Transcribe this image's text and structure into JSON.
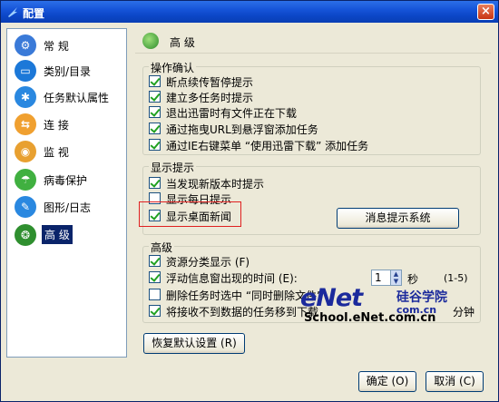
{
  "window": {
    "title": "配置",
    "close": "×"
  },
  "sidebar": {
    "items": [
      {
        "label": "常 规",
        "icon": "settings-icon",
        "color": "#3a7ad8"
      },
      {
        "label": "类别/目录",
        "icon": "folder-icon",
        "color": "#1c78d8"
      },
      {
        "label": "任务默认属性",
        "icon": "gear-icon",
        "color": "#2a88e0"
      },
      {
        "label": "连 接",
        "icon": "connection-icon",
        "color": "#f0a030"
      },
      {
        "label": "监 视",
        "icon": "monitor-icon",
        "color": "#e8a030"
      },
      {
        "label": "病毒保护",
        "icon": "virus-protection-icon",
        "color": "#40b040"
      },
      {
        "label": "图形/日志",
        "icon": "log-icon",
        "color": "#2a88e0"
      },
      {
        "label": "高 级",
        "icon": "advanced-icon",
        "color": "#2f8f2f"
      }
    ]
  },
  "header": {
    "title": "高 级"
  },
  "group_confirm": {
    "title": "操作确认",
    "items": [
      {
        "label": "断点续传暂停提示",
        "checked": true
      },
      {
        "label": "建立多任务时提示",
        "checked": true
      },
      {
        "label": "退出迅雷时有文件正在下载",
        "checked": true
      },
      {
        "label": "通过拖曳URL到悬浮窗添加任务",
        "checked": true
      },
      {
        "label": "通过IE右键菜单 “使用迅雷下载” 添加任务",
        "checked": true
      }
    ]
  },
  "group_display": {
    "title": "显示提示",
    "items": [
      {
        "label": "当发现新版本时提示",
        "checked": true
      },
      {
        "label": "显示每日提示",
        "checked": false
      },
      {
        "label": "显示桌面新闻",
        "checked": true
      }
    ],
    "button": "消息提示系统"
  },
  "group_advanced": {
    "title": "高级",
    "items": [
      {
        "label": "资源分类显示 (F)",
        "checked": true
      },
      {
        "label": "浮动信息窗出现的时间 (E):",
        "checked": true
      },
      {
        "label": "删除任务时选中 “同时删除文件”",
        "checked": false
      },
      {
        "label": "将接收不到数据的任务移到下载",
        "checked": true
      }
    ],
    "spin_value": "1",
    "spin_unit": "秒",
    "spin_range": "(1-5)",
    "tail_text": "分钟"
  },
  "buttons": {
    "restore": "恢复默认设置 (R)",
    "ok": "确定 (O)",
    "cancel": "取消 (C)"
  },
  "watermark": {
    "logo": "eNet",
    "cn": "硅谷学院",
    "com": "com.cn",
    "school": "School.eNet.com.cn"
  }
}
